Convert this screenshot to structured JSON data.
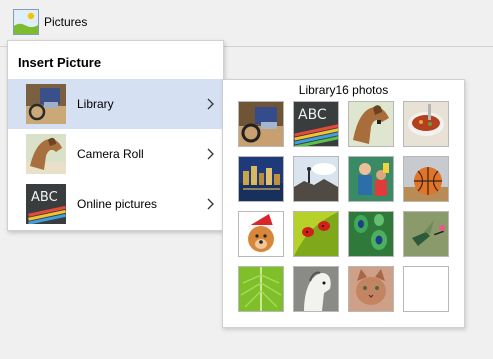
{
  "ribbon": {
    "pictures_label": "Pictures"
  },
  "menu": {
    "title": "Insert Picture",
    "items": [
      {
        "label": "Library",
        "thumb": "motorcycle-thumb-icon",
        "selected": true
      },
      {
        "label": "Camera Roll",
        "thumb": "horse-thumb-icon",
        "selected": false
      },
      {
        "label": "Online pictures",
        "thumb": "abc-chalk-thumb-icon",
        "selected": false
      }
    ]
  },
  "library": {
    "header": "Library16 photos",
    "photos": [
      "motorcycle-photo-icon",
      "abc-chalk-photo-icon",
      "horse-photo-icon",
      "soup-bowl-photo-icon",
      "city-night-photo-icon",
      "rocks-sky-photo-icon",
      "children-photo-icon",
      "basketball-photo-icon",
      "dog-santa-hat-photo-icon",
      "ladybugs-photo-icon",
      "peacock-feathers-photo-icon",
      "hummingbird-photo-icon",
      "green-leaf-photo-icon",
      "white-horse-photo-icon",
      "cat-photo-icon",
      "empty-photo-slot"
    ]
  },
  "colors": {
    "selected_row": "#d5e1f2",
    "ribbon": "#f0f0f0",
    "border": "#d0d0d0"
  }
}
